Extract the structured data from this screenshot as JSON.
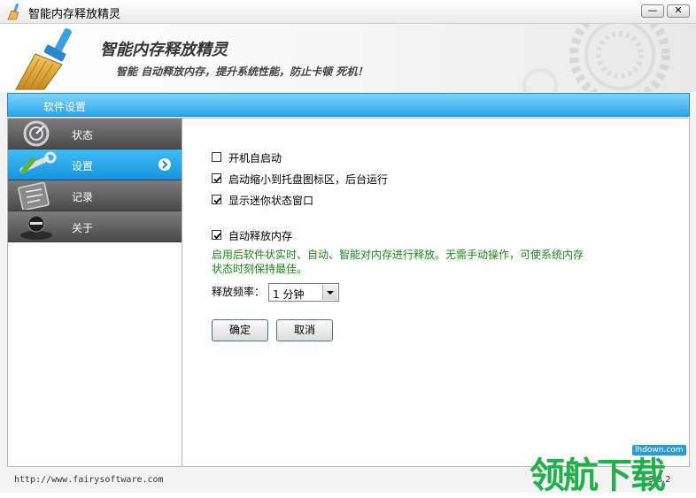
{
  "window": {
    "title": "智能内存释放精灵",
    "min_glyph": "—",
    "close_glyph": "✕"
  },
  "header": {
    "title": "智能内存释放精灵",
    "subtitle": "智能 自动释放内存，提升系统性能，防止卡顿 死机！"
  },
  "section_bar": {
    "label": "软件设置"
  },
  "sidebar": {
    "items": [
      {
        "label": "状态",
        "icon": "gauge-icon",
        "active": false
      },
      {
        "label": "设置",
        "icon": "tools-icon",
        "active": true
      },
      {
        "label": "记录",
        "icon": "clipboard-icon",
        "active": false
      },
      {
        "label": "关于",
        "icon": "ninja-icon",
        "active": false
      }
    ]
  },
  "settings": {
    "startup": {
      "label": "开机自启动",
      "checked": false
    },
    "tray": {
      "label": "启动缩小到托盘图标区，后台运行",
      "checked": true
    },
    "mini_window": {
      "label": "显示迷你状态窗口",
      "checked": true
    },
    "auto_release": {
      "label": "自动释放内存",
      "checked": true
    },
    "description": "启用后软件状实时、自动、智能对内存进行释放。无需手动操作，可使系统内存状态时刻保持最佳。",
    "frequency_label": "释放频率：",
    "frequency_value": "1 分钟",
    "ok_label": "确定",
    "cancel_label": "取消"
  },
  "footer": {
    "url": "http://www.fairysoftware.com",
    "version": "3.8.2"
  },
  "watermark": {
    "text": "领航下载",
    "badge": "lhdown.com"
  },
  "colors": {
    "accent_blue": "#2ba4ea",
    "nav_gray": "#4a4a4a",
    "desc_green": "#1a8a1a",
    "watermark_green": "#21b04b"
  }
}
